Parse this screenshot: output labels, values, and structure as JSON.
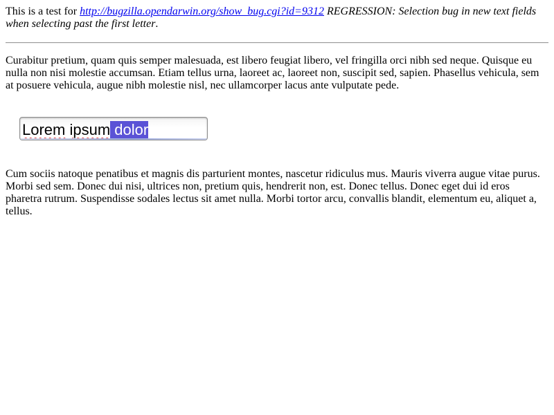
{
  "intro": {
    "prefix": "This is a test for ",
    "link_text": "http://bugzilla.opendarwin.org/show_bug.cgi?id=9312",
    "title": " REGRESSION: Selection bug in new text fields when selecting past the first letter",
    "suffix": "."
  },
  "paragraph1": "Curabitur pretium, quam quis semper malesuada, est libero feugiat libero, vel fringilla orci nibh sed neque. Quisque eu nulla non nisi molestie accumsan. Etiam tellus urna, laoreet ac, laoreet non, suscipit sed, sapien. Phasellus vehicula, sem at posuere vehicula, augue nibh molestie nisl, nec ullamcorper lacus ante vulputate pede.",
  "textfield": {
    "word1": "Lorem",
    "space1": " ",
    "word2": "ipsum",
    "selected_text": " dolor"
  },
  "paragraph2": "Cum sociis natoque penatibus et magnis dis parturient montes, nascetur ridiculus mus. Mauris viverra augue vitae purus. Morbi sed sem. Donec dui nisi, ultrices non, pretium quis, hendrerit non, est. Donec tellus. Donec eget dui id eros pharetra rutrum. Suspendisse sodales lectus sit amet nulla. Morbi tortor arcu, convallis blandit, elementum eu, aliquet a, tellus.",
  "colors": {
    "link": "#0000ee",
    "selection": "#5a52d6",
    "spellcheck": "#e04040"
  }
}
